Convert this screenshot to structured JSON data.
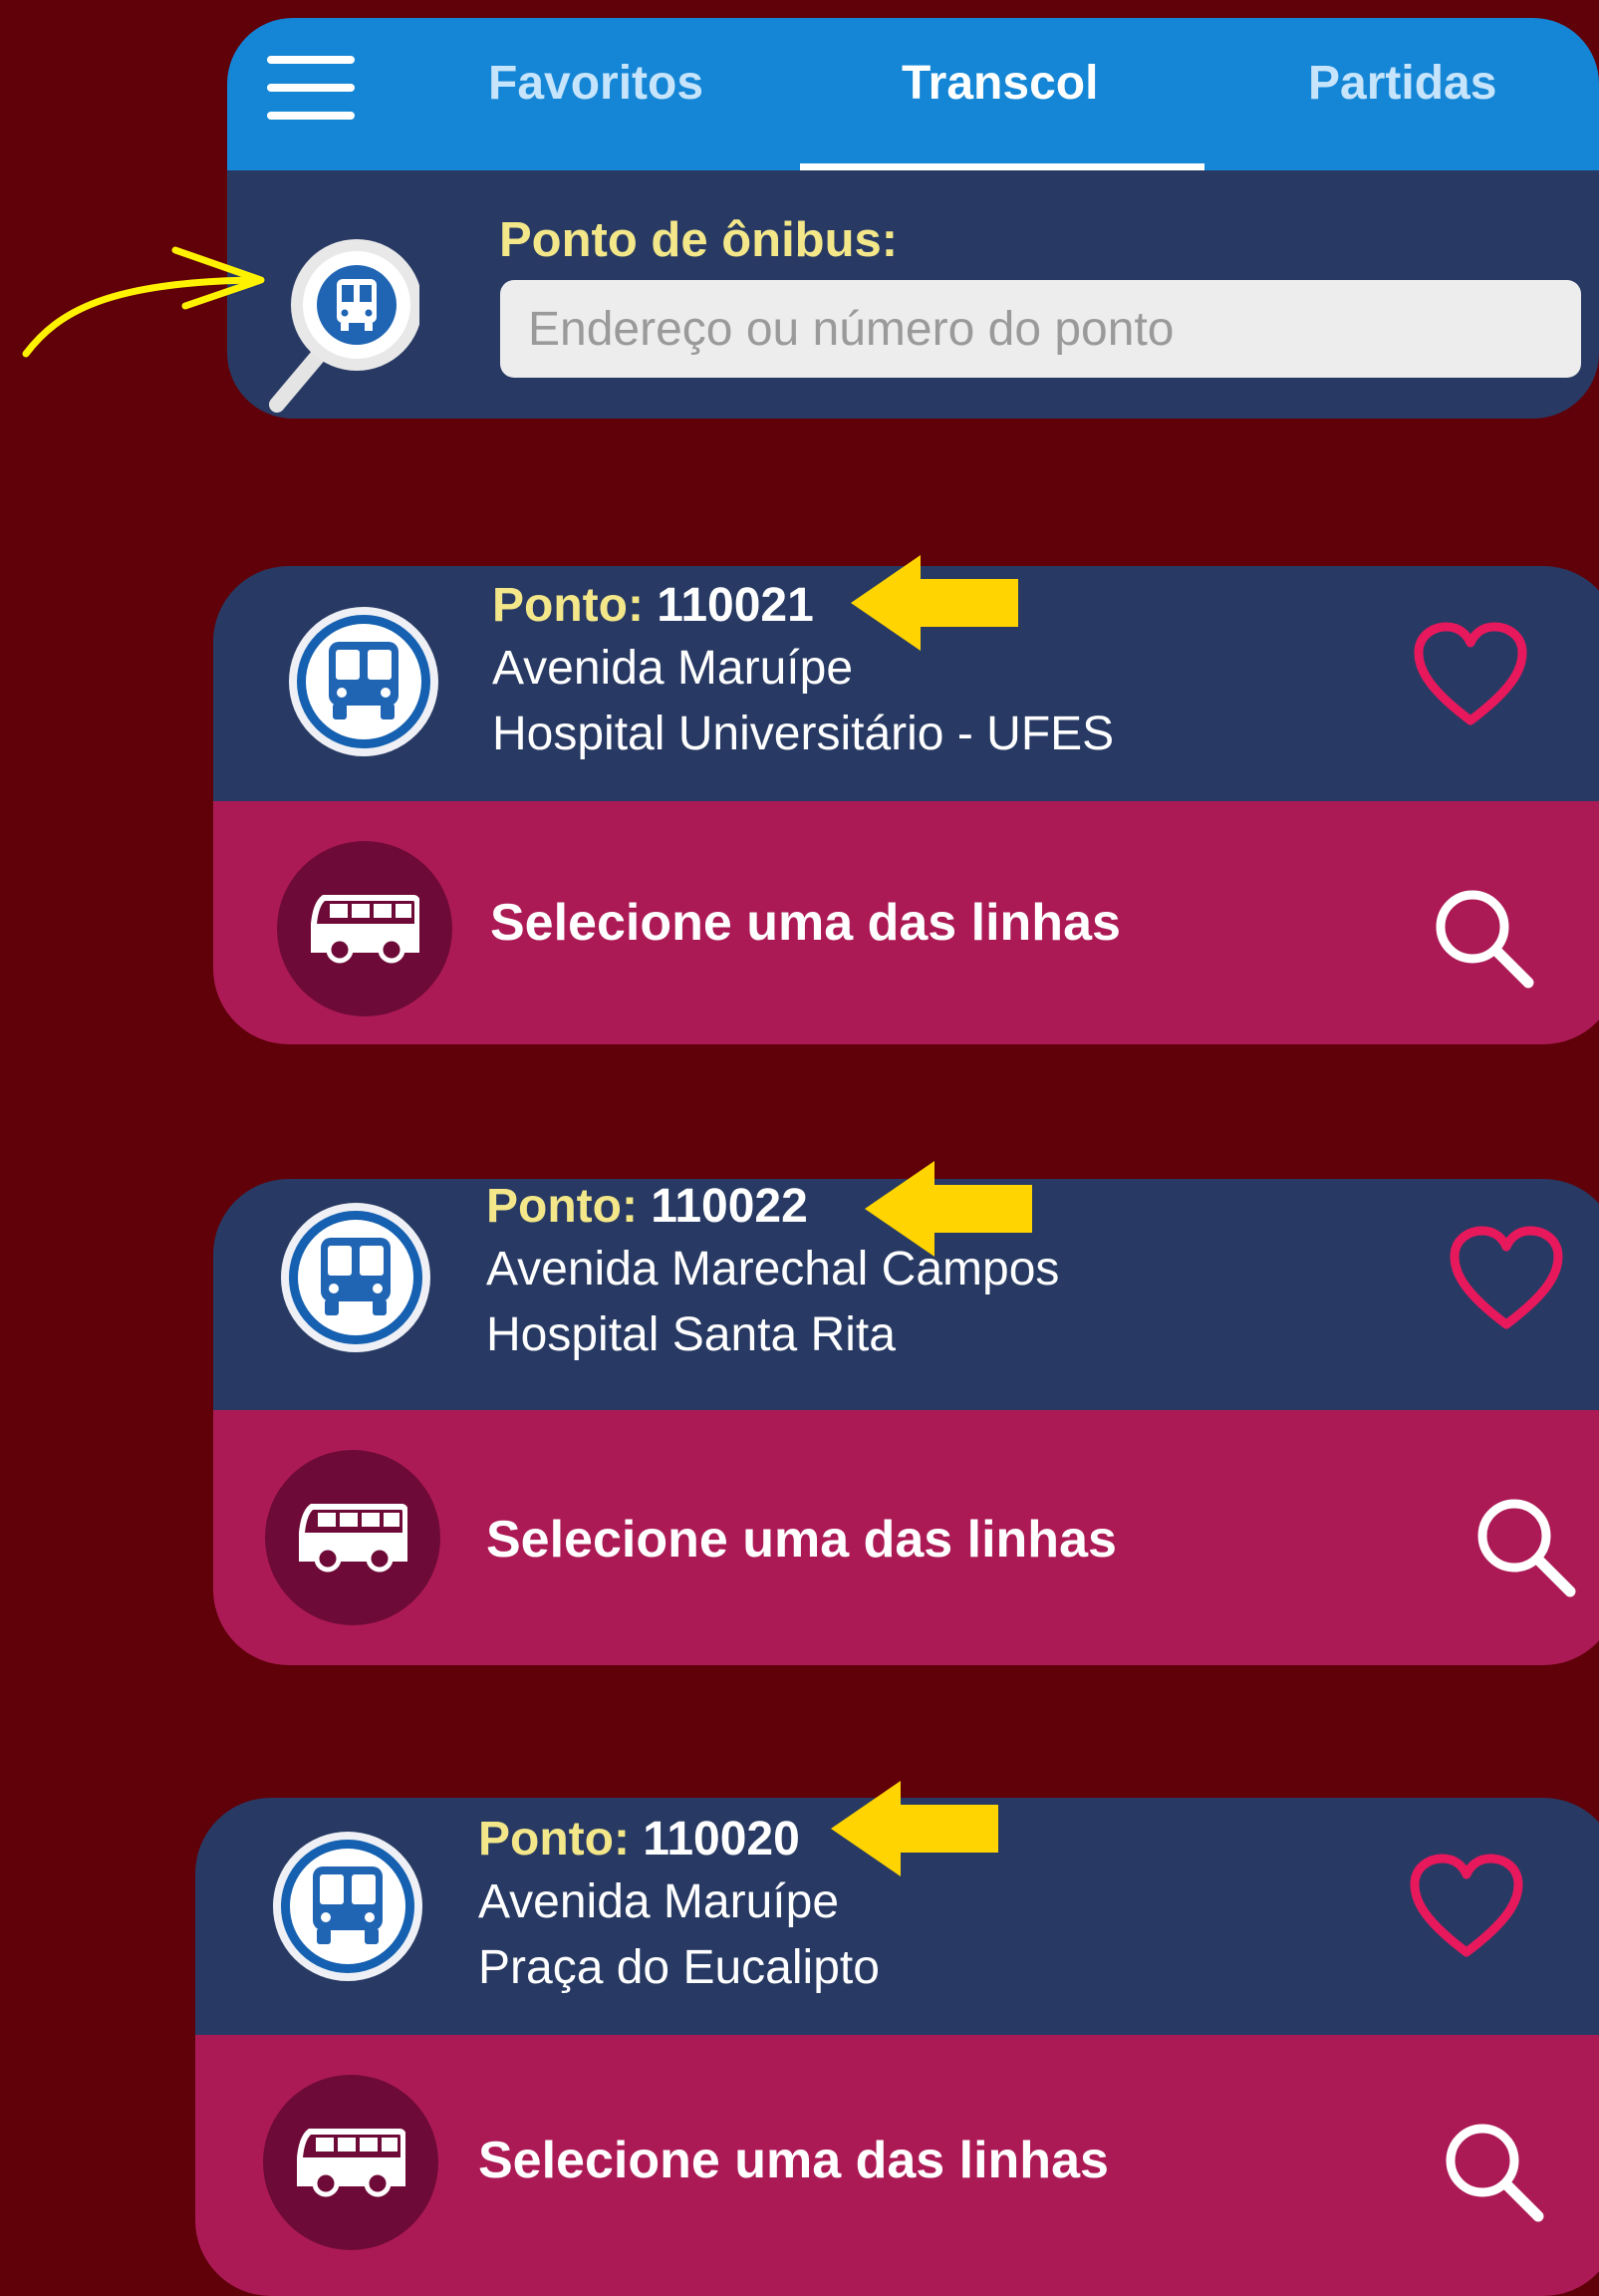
{
  "header": {
    "tabs": [
      {
        "label": "Favoritos",
        "active": false
      },
      {
        "label": "Transcol",
        "active": true
      },
      {
        "label": "Partidas",
        "active": false
      }
    ],
    "search": {
      "label": "Ponto de ônibus:",
      "placeholder": "Endereço ou número do ponto",
      "value": ""
    }
  },
  "stops": [
    {
      "prefix": "Ponto:",
      "number": "110021",
      "street": "Avenida Maruípe",
      "reference": "Hospital Universitário - UFES",
      "action_label": "Selecione uma das linhas"
    },
    {
      "prefix": "Ponto:",
      "number": "110022",
      "street": "Avenida Marechal Campos",
      "reference": "Hospital Santa Rita",
      "action_label": "Selecione uma das linhas"
    },
    {
      "prefix": "Ponto:",
      "number": "110020",
      "street": "Avenida Maruípe",
      "reference": "Praça do Eucalipto",
      "action_label": "Selecione uma das linhas"
    }
  ],
  "colors": {
    "background": "#600009",
    "tabbar": "#1486d5",
    "panel": "#283a63",
    "action_row": "#ac1a56",
    "heart": "#e8185c",
    "label_yellow": "#f3e789",
    "arrow_yellow": "#ffd400"
  },
  "icons": [
    "menu-icon",
    "bus-search-icon",
    "bus-front-icon",
    "heart-icon",
    "coach-bus-icon",
    "search-icon",
    "yellow-arrow-icon"
  ]
}
